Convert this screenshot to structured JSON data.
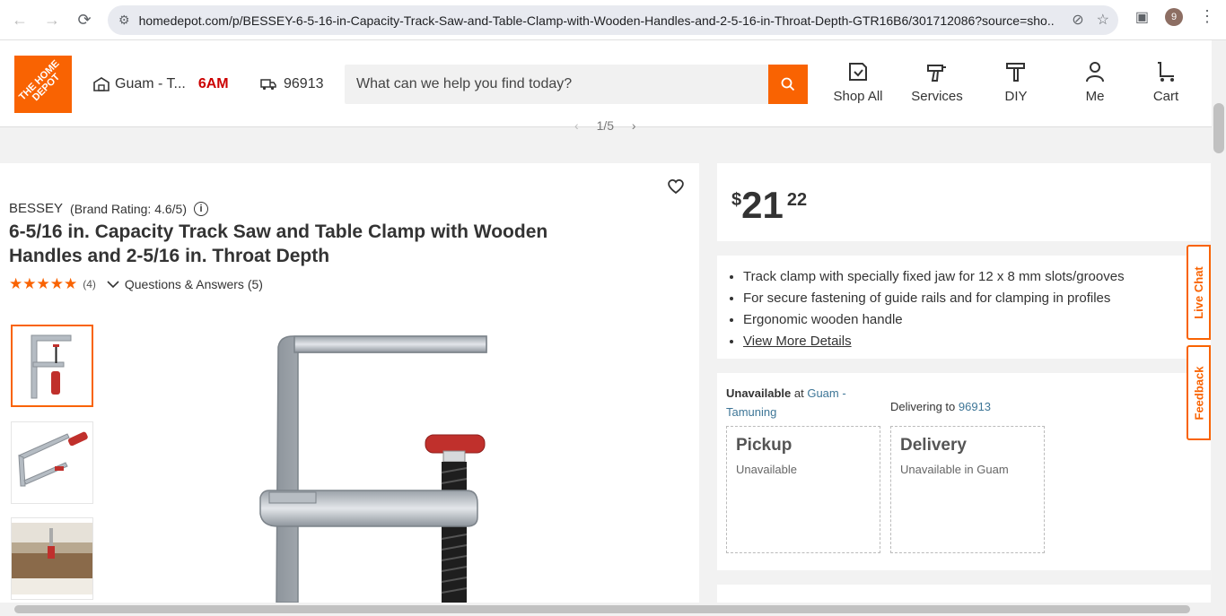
{
  "browser": {
    "url": "homedepot.com/p/BESSEY-6-5-16-in-Capacity-Track-Saw-and-Table-Clamp-with-Wooden-Handles-and-2-5-16-in-Throat-Depth-GTR16B6/301712086?source=sho...",
    "profile_initial": "9"
  },
  "header": {
    "logo_text": "THE HOME DEPOT",
    "store_name": "Guam - T...",
    "store_hours": "6AM",
    "zip": "96913",
    "search_placeholder": "What can we help you find today?",
    "nav": [
      {
        "label": "Shop All",
        "icon": "shop-all-icon"
      },
      {
        "label": "Services",
        "icon": "services-icon"
      },
      {
        "label": "DIY",
        "icon": "diy-hammer-icon"
      },
      {
        "label": "Me",
        "icon": "user-icon"
      },
      {
        "label": "Cart",
        "icon": "cart-icon"
      }
    ],
    "accent": "#f96302"
  },
  "carousel": {
    "indicator": "1/5"
  },
  "product": {
    "brand": "BESSEY",
    "brand_rating": "(Brand Rating: 4.6/5)",
    "title": "6-5/16 in. Capacity Track Saw and Table Clamp with Wooden Handles and 2-5/16 in. Throat Depth",
    "stars": "★★★★★",
    "review_count": "(4)",
    "qa_label": "Questions & Answers (5)",
    "thumbnails": 3
  },
  "price": {
    "currency": "$",
    "dollars": "21",
    "cents": "22"
  },
  "highlights": [
    "Track clamp with specially fixed jaw for 12 x 8 mm slots/grooves",
    "For secure fastening of guide rails and for clamping in profiles",
    "Ergonomic wooden handle"
  ],
  "view_more": "View More Details",
  "fulfillment": {
    "unavailable_label": "Unavailable",
    "at": " at ",
    "store": "Guam - Tamuning",
    "delivering_to": "Delivering to ",
    "delivery_zip": "96913",
    "pickup_title": "Pickup",
    "pickup_status": "Unavailable",
    "delivery_title": "Delivery",
    "delivery_status": "Unavailable in Guam"
  },
  "side_tabs": {
    "live_chat": "Live Chat",
    "feedback": "Feedback"
  }
}
